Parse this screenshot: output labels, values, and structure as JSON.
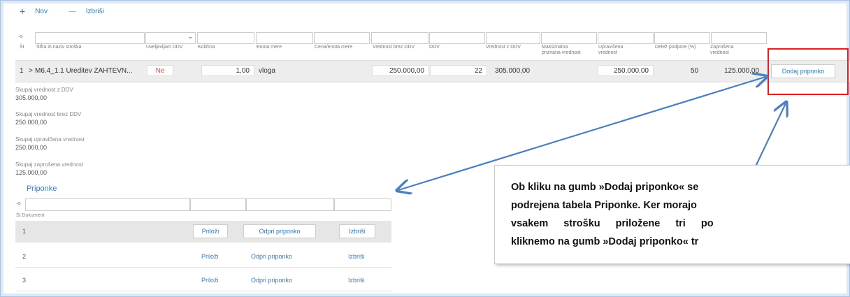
{
  "toolbar": {
    "new_label": "Nov",
    "delete_label": "Izbriši"
  },
  "table": {
    "headers": {
      "st": "Št",
      "sifra": "Šifra in naziv stroška",
      "uveljavljam": "Uveljavljam DDV",
      "kolicina": "Količina",
      "enota": "Enota mere",
      "cena": "Cena/enota mere",
      "brez": "Vrednost brez DDV",
      "ddv": "DDV",
      "zddv": "Vrednost z DDV",
      "maks1": "Maksimalna",
      "maks2": "priznana vrednost",
      "upr1": "Upravičena",
      "upr2": "vrednost",
      "delez": "Delež podpore (%)",
      "zapr1": "Zaprošena",
      "zapr2": "vrednost"
    },
    "row": {
      "num": "1",
      "expand": ">",
      "name": "M6.4_1.1 Ureditev ZAHTEVN...",
      "ddv_flag": "Ne",
      "kolicina": "1,00",
      "enota": "vloga",
      "brez": "250.000,00",
      "ddv": "22",
      "zddv": "305.000,00",
      "upravicena": "250.000,00",
      "delez": "50",
      "zaprosena": "125.000,00",
      "add_attachment": "Dodaj priponko"
    }
  },
  "summary": [
    {
      "label": "Skupaj vrednost z DDV",
      "value": "305.000,00"
    },
    {
      "label": "Skupaj vrednost brez DDV",
      "value": "250.000,00"
    },
    {
      "label": "Skupaj upravičena vrednost",
      "value": "250.000,00"
    },
    {
      "label": "Skupaj zaprošena vrednost",
      "value": "125.000,00"
    }
  ],
  "attachments": {
    "title": "Priponke",
    "header": "Št Dokument",
    "rows": [
      {
        "num": "1",
        "attach": "Priloži",
        "open": "Odpri priponko",
        "delete": "Izbriši"
      },
      {
        "num": "2",
        "attach": "Priloži",
        "open": "Odpri priponko",
        "delete": "Izbriši"
      },
      {
        "num": "3",
        "attach": "Priloži",
        "open": "Odpri priponko",
        "delete": "Izbriši"
      }
    ]
  },
  "callout": {
    "line1": "Ob kliku na gumb »Dodaj priponko« se",
    "line2": "podrejena tabela Priponke. Ker morajo",
    "line3": "vsakem strošku priložene tri po",
    "line4": "kliknemo na gumb »Dodaj priponko« tr"
  },
  "colors": {
    "accent": "#2b7bb9",
    "highlight_box": "#e02020",
    "arrow": "#4a7fc0"
  }
}
